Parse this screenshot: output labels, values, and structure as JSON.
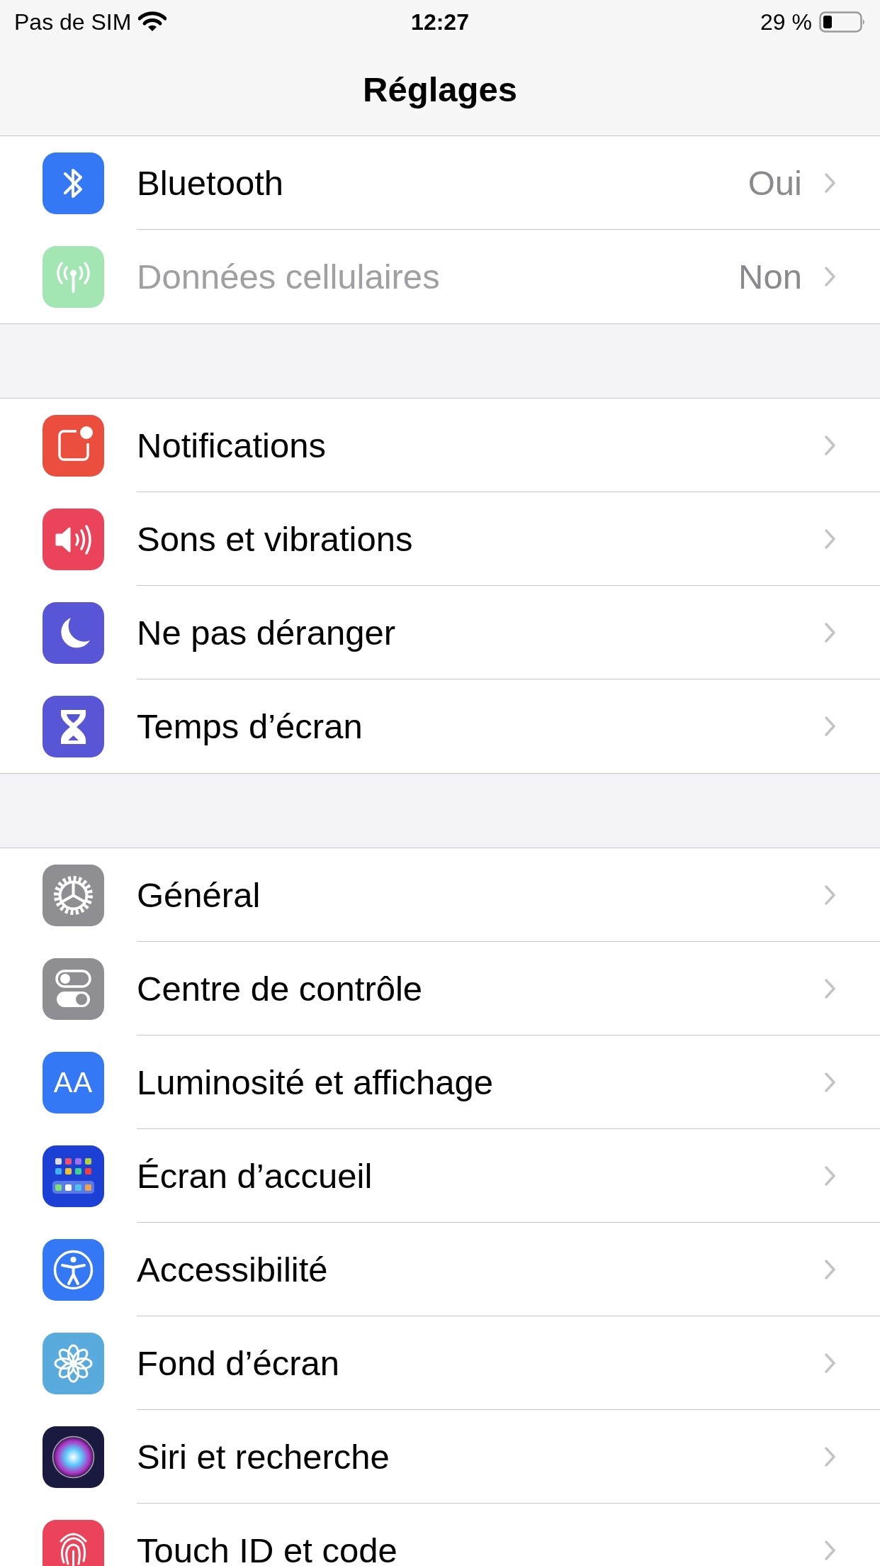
{
  "status_bar": {
    "carrier": "Pas de SIM",
    "time": "12:27",
    "battery": "29 %"
  },
  "nav": {
    "title": "Réglages"
  },
  "groups": [
    {
      "rows": [
        {
          "label": "Bluetooth",
          "value": "Oui",
          "disabled": false
        },
        {
          "label": "Données cellulaires",
          "value": "Non",
          "disabled": true
        }
      ]
    },
    {
      "rows": [
        {
          "label": "Notifications",
          "disabled": false
        },
        {
          "label": "Sons et vibrations",
          "disabled": false
        },
        {
          "label": "Ne pas déranger",
          "disabled": false
        },
        {
          "label": "Temps d’écran",
          "disabled": false
        }
      ]
    },
    {
      "rows": [
        {
          "label": "Général",
          "disabled": false
        },
        {
          "label": "Centre de contrôle",
          "disabled": false
        },
        {
          "label": "Luminosité et affichage",
          "icon_text": "AA",
          "disabled": false
        },
        {
          "label": "Écran d’accueil",
          "disabled": false
        },
        {
          "label": "Accessibilité",
          "disabled": false
        },
        {
          "label": "Fond d’écran",
          "disabled": false
        },
        {
          "label": "Siri et recherche",
          "disabled": false
        },
        {
          "label": "Touch ID et code",
          "disabled": false
        }
      ]
    }
  ]
}
